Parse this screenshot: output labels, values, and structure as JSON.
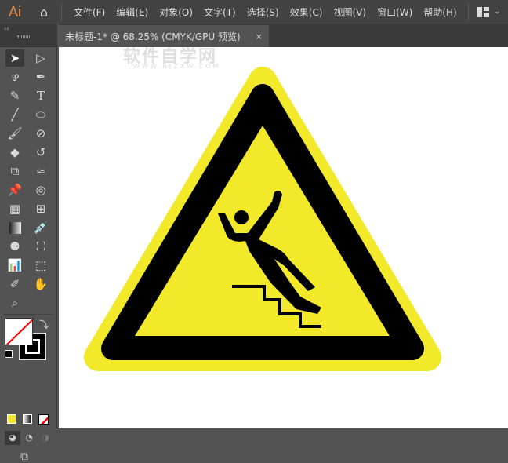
{
  "app": {
    "logo": "Ai",
    "home_icon": "home-icon"
  },
  "menu": [
    "文件(F)",
    "编辑(E)",
    "对象(O)",
    "文字(T)",
    "选择(S)",
    "效果(C)",
    "视图(V)",
    "窗口(W)",
    "帮助(H)"
  ],
  "document_tab": {
    "title": "未标题-1* @ 68.25% (CMYK/GPU 预览)",
    "close": "×"
  },
  "toolbar": {
    "collapse": "‹‹"
  },
  "watermark": {
    "text": "软件自学网",
    "url": "WWW.RJZXW.COM"
  },
  "colors": {
    "sign_yellow": "#f2e92a",
    "sign_black": "#000000",
    "fill_swatch": "#ffffff",
    "stroke_swatch": "#000000",
    "color_mode": "#f2e92a"
  },
  "artwork": {
    "name": "slippery-stairs-warning-sign"
  }
}
